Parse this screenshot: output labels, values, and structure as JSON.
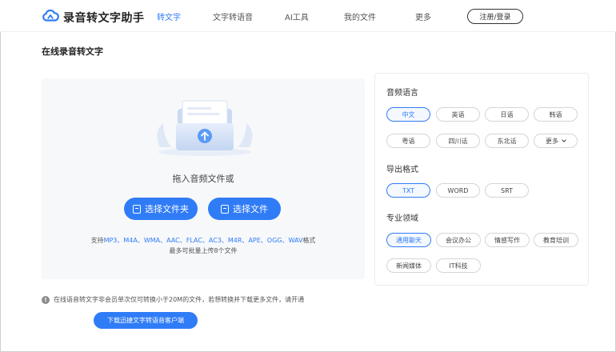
{
  "header": {
    "app_name": "录音转文字助手",
    "nav": [
      "转文字",
      "文字转语音",
      "AI工具",
      "我的文件",
      "更多"
    ],
    "login_label": "注册/登录"
  },
  "page_title": "在线录音转文字",
  "upload": {
    "drag_text": "拖入音频文件或",
    "choose_folder": "选择文件夹",
    "choose_file": "选择文件",
    "support_prefix": "支持",
    "formats": "MP3、M4A、WMA、AAC、FLAC、AC3、M4R、APE、OGG、WAV",
    "support_suffix": "格式",
    "limit": "最多可批量上传8个文件"
  },
  "notice": {
    "text": "在线语音转文字非会员单次仅可转换小于20M的文件，若想转换并下载更多文件，请开通",
    "download_label": "下载迅捷文字转语音客户端"
  },
  "settings": {
    "language_title": "音频语言",
    "languages": [
      "中文",
      "英语",
      "日语",
      "韩语",
      "粤语",
      "四川话",
      "东北话",
      "更多"
    ],
    "export_title": "导出格式",
    "exports": [
      "TXT",
      "WORD",
      "SRT"
    ],
    "domain_title": "专业领域",
    "domains": [
      "通用聊天",
      "会议办公",
      "情感写作",
      "教育培训",
      "新闻媒体",
      "IT科技"
    ]
  },
  "colors": {
    "accent": "#2f7cf6",
    "panel_bg": "#f7f8fa"
  },
  "icons": [
    "cloud-logo-icon",
    "folder-icon",
    "file-icon",
    "upload-arrow-icon",
    "info-icon",
    "chevron-down-icon"
  ]
}
